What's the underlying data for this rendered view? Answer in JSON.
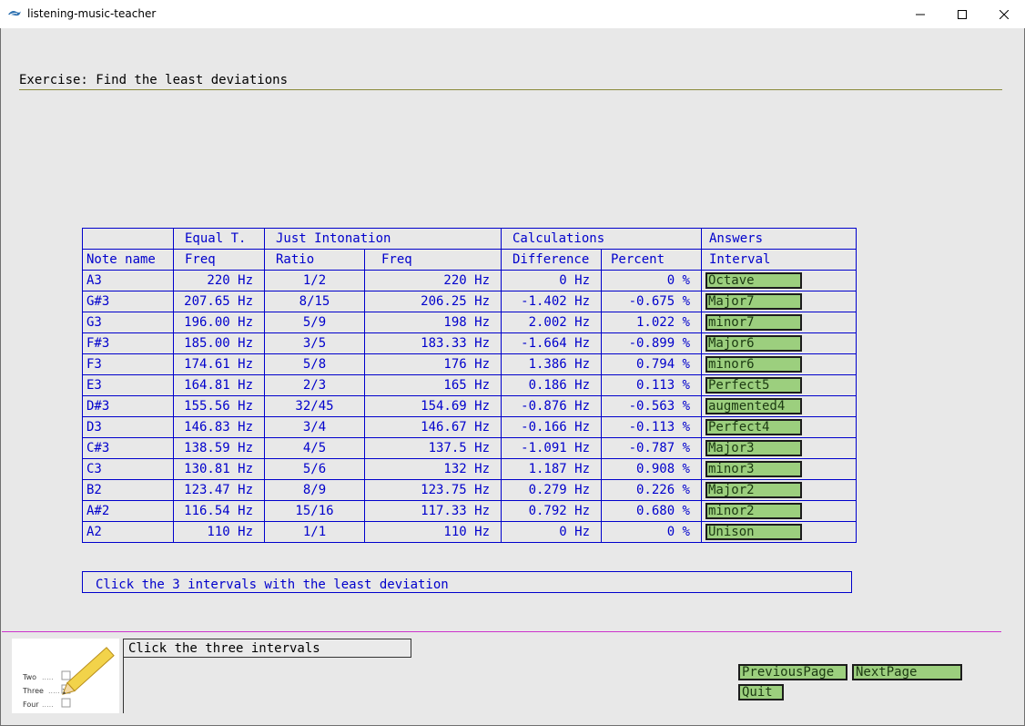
{
  "window": {
    "title": "listening-music-teacher"
  },
  "exercise": {
    "heading": "Exercise: Find the least deviations"
  },
  "table": {
    "group_headers": {
      "equal": "Equal T.",
      "just": "Just Intonation",
      "calc": "Calculations",
      "answers": "Answers"
    },
    "columns": [
      "Note name",
      "Freq",
      "Ratio",
      "Freq",
      "Difference",
      "Percent",
      "Interval"
    ],
    "rows": [
      {
        "note": "A3",
        "freq": "220 Hz",
        "ratio": "1/2",
        "just_freq": "220 Hz",
        "diff": "0 Hz",
        "pct": "0 %",
        "interval": "Octave"
      },
      {
        "note": "G#3",
        "freq": "207.65 Hz",
        "ratio": "8/15",
        "just_freq": "206.25 Hz",
        "diff": "-1.402 Hz",
        "pct": "-0.675 %",
        "interval": "Major7"
      },
      {
        "note": "G3",
        "freq": "196.00 Hz",
        "ratio": "5/9",
        "just_freq": "198 Hz",
        "diff": "2.002 Hz",
        "pct": "1.022 %",
        "interval": "minor7"
      },
      {
        "note": "F#3",
        "freq": "185.00 Hz",
        "ratio": "3/5",
        "just_freq": "183.33 Hz",
        "diff": "-1.664 Hz",
        "pct": "-0.899 %",
        "interval": "Major6"
      },
      {
        "note": "F3",
        "freq": "174.61 Hz",
        "ratio": "5/8",
        "just_freq": "176 Hz",
        "diff": "1.386 Hz",
        "pct": "0.794 %",
        "interval": "minor6"
      },
      {
        "note": "E3",
        "freq": "164.81 Hz",
        "ratio": "2/3",
        "just_freq": "165 Hz",
        "diff": "0.186 Hz",
        "pct": "0.113 %",
        "interval": "Perfect5"
      },
      {
        "note": "D#3",
        "freq": "155.56 Hz",
        "ratio": "32/45",
        "just_freq": "154.69 Hz",
        "diff": "-0.876 Hz",
        "pct": "-0.563 %",
        "interval": "augmented4"
      },
      {
        "note": "D3",
        "freq": "146.83 Hz",
        "ratio": "3/4",
        "just_freq": "146.67 Hz",
        "diff": "-0.166 Hz",
        "pct": "-0.113 %",
        "interval": "Perfect4"
      },
      {
        "note": "C#3",
        "freq": "138.59 Hz",
        "ratio": "4/5",
        "just_freq": "137.5 Hz",
        "diff": "-1.091 Hz",
        "pct": "-0.787 %",
        "interval": "Major3"
      },
      {
        "note": "C3",
        "freq": "130.81 Hz",
        "ratio": "5/6",
        "just_freq": "132 Hz",
        "diff": "1.187 Hz",
        "pct": "0.908 %",
        "interval": "minor3"
      },
      {
        "note": "B2",
        "freq": "123.47 Hz",
        "ratio": "8/9",
        "just_freq": "123.75 Hz",
        "diff": "0.279 Hz",
        "pct": "0.226 %",
        "interval": "Major2"
      },
      {
        "note": "A#2",
        "freq": "116.54 Hz",
        "ratio": "15/16",
        "just_freq": "117.33 Hz",
        "diff": "0.792 Hz",
        "pct": "0.680 %",
        "interval": "minor2"
      },
      {
        "note": "A2",
        "freq": "110 Hz",
        "ratio": "1/1",
        "just_freq": "110 Hz",
        "diff": "0 Hz",
        "pct": "0 %",
        "interval": "Unison"
      }
    ]
  },
  "instruction": "Click the 3 intervals with the least deviation",
  "status": "Click the three intervals",
  "thumbnail": {
    "labels": [
      "Two",
      "Three",
      "Four"
    ],
    "dots": "....."
  },
  "nav": {
    "previous": "PreviousPage",
    "next": "NextPage",
    "quit": "Quit"
  },
  "colors": {
    "table_text": "#0000cc",
    "answer_button": "#9ccf7e",
    "rule_magenta": "#cc33cc"
  }
}
